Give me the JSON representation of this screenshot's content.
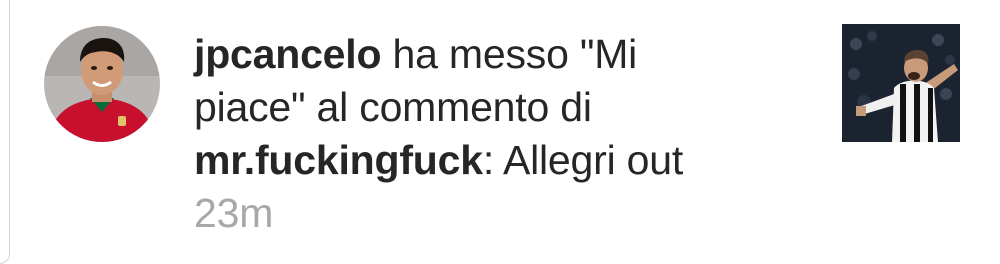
{
  "notification": {
    "actor_username": "jpcancelo",
    "action_text": " ha messo \"Mi piace\" al commento di ",
    "target_username": "mr.fuckingfuck",
    "comment_prefix": ": ",
    "comment_text": "Allegri out",
    "timestamp": "23m",
    "avatar_icon": "profile-photo-avatar",
    "thumbnail_icon": "post-thumbnail-photo"
  },
  "colors": {
    "text": "#262626",
    "timestamp": "#a8a8a8",
    "background": "#ffffff"
  }
}
